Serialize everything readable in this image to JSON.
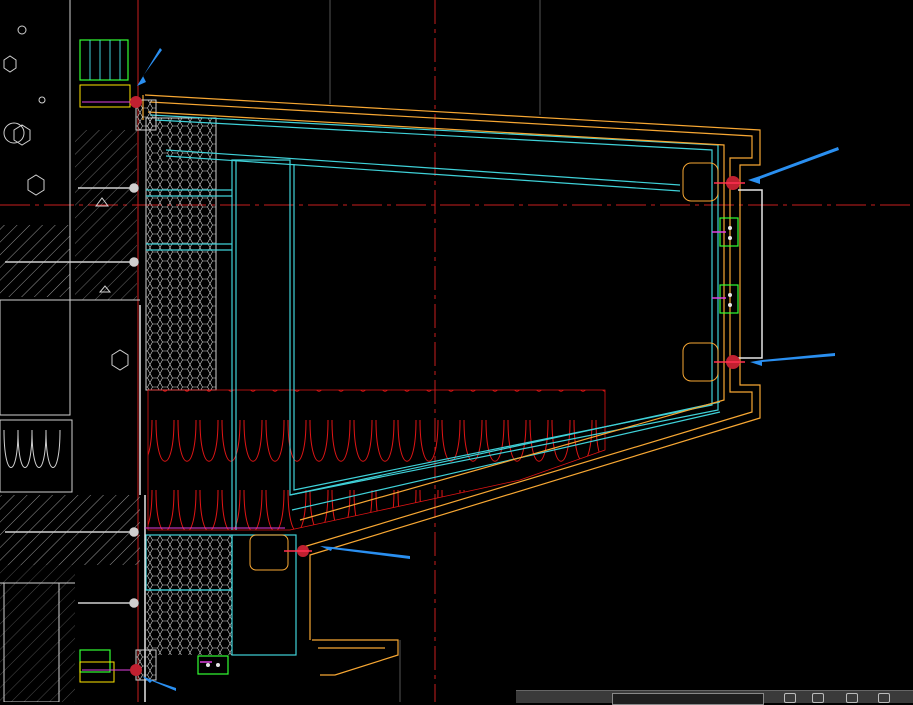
{
  "colors": {
    "background": "#000000",
    "frame_orange": "#f7a733",
    "glass_cyan": "#3fd1d8",
    "insulation_red": "#e01414",
    "centerline_red": "#c81e1e",
    "outline_white": "#e6e6e6",
    "annotation_arrow": "#2a8ff0",
    "green_part": "#33ff33",
    "magenta_part": "#e040e0",
    "bolt_dark_red": "#c02030"
  },
  "icons": [
    "detail-arrow-icon",
    "bolt-icon",
    "bracket-icon"
  ],
  "statusbar": {
    "field_value": ""
  }
}
